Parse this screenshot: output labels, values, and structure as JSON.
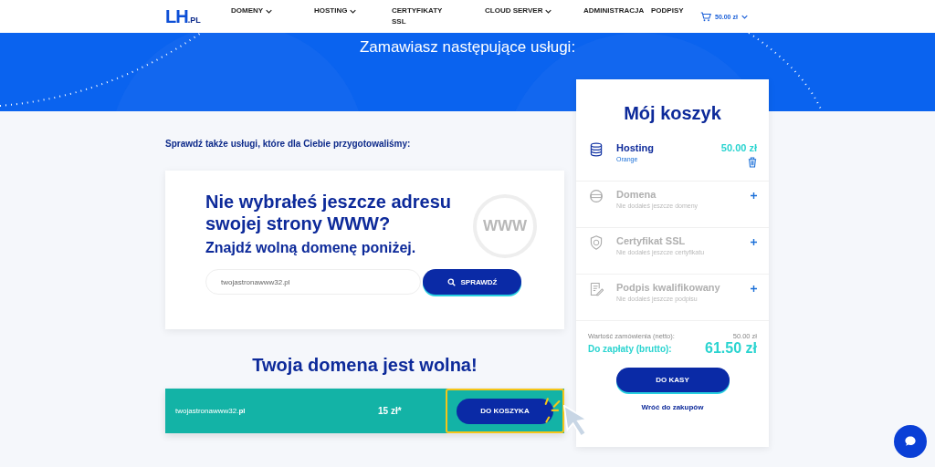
{
  "logo": {
    "main": "LH",
    "suffix": ".PL"
  },
  "nav": [
    {
      "label": "DOMENY",
      "dropdown": true
    },
    {
      "label": "HOSTING",
      "dropdown": true
    },
    {
      "label": "CERTYFIKATY SSL",
      "dropdown": false
    },
    {
      "label": "CLOUD SERVER",
      "dropdown": true
    },
    {
      "label": "ADMINISTRACJA",
      "dropdown": false
    },
    {
      "label": "PODPISY",
      "dropdown": false
    }
  ],
  "cart_link": {
    "amount": "50.00 zł"
  },
  "banner": {
    "title": "Zamawiasz następujące usługi:"
  },
  "suggest_heading": "Sprawdź także usługi, które dla Ciebie przygotowaliśmy:",
  "domain_card": {
    "title": "Nie wybrałeś jeszcze adresu swojej strony WWW?",
    "subtitle": "Znajdź wolną domenę poniżej.",
    "badge": "WWW",
    "search_value": "twojastronawww32.pl",
    "search_button": "SPRAWDŹ"
  },
  "result": {
    "heading": "Twoja domena jest wolna!",
    "domain": "twojastronawww32.**pl**",
    "price": "15 zł*",
    "button": "DO KOSZYKA",
    "highlighted": true
  },
  "cart": {
    "title": "Mój koszyk",
    "items": [
      {
        "kind": "database",
        "name": "Hosting",
        "detail": "Orange",
        "price": "50.00 zł",
        "added": true
      },
      {
        "kind": "globe",
        "name": "Domena",
        "detail": "Nie dodałeś jeszcze domeny",
        "added": false
      },
      {
        "kind": "shield",
        "name": "Certyfikat SSL",
        "detail": "Nie dodałeś jeszcze certyfikatu",
        "added": false
      },
      {
        "kind": "document",
        "name": "Podpis kwalifikowany",
        "detail": "Nie dodałeś jeszcze podpisu",
        "added": false
      }
    ],
    "net_label": "Wartość zamówienia (netto):",
    "net_value": "50.00 zł",
    "gross_label": "Do zapłaty (brutto):",
    "gross_value": "61.50 zł",
    "checkout": "DO KASY",
    "back": "Wróć do zakupów"
  }
}
